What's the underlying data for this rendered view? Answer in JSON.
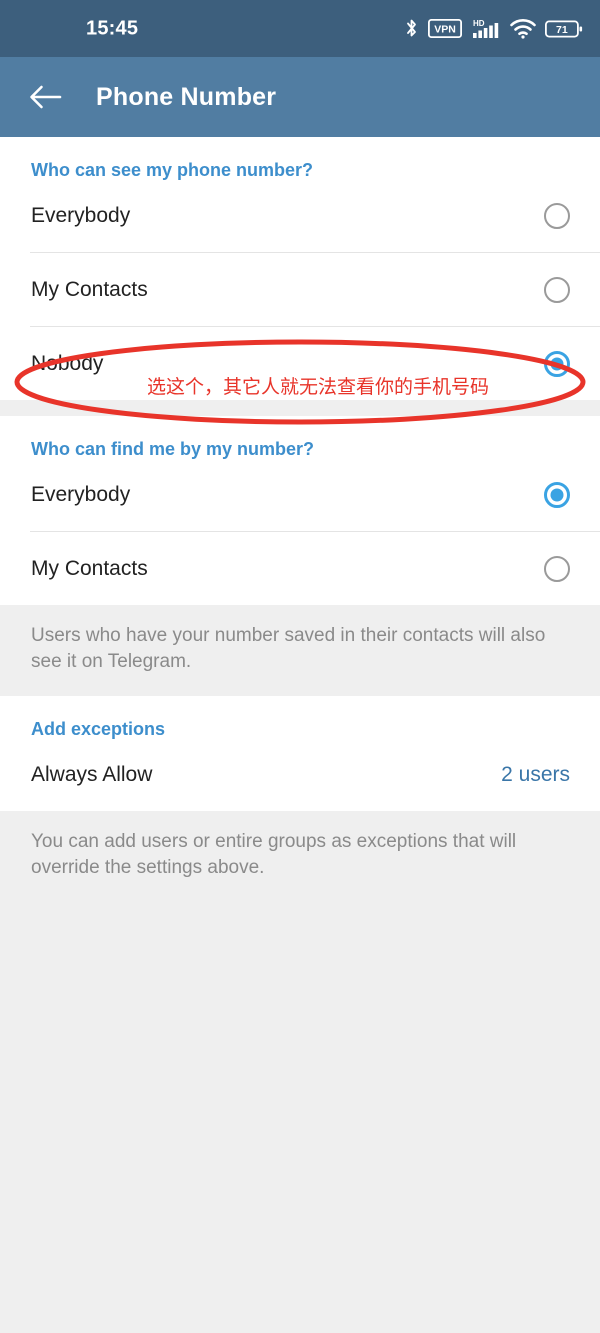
{
  "status_bar": {
    "time": "15:45",
    "battery_level": "71",
    "icons": [
      "bluetooth-icon",
      "vpn-icon",
      "hd-signal-icon",
      "wifi-icon",
      "battery-icon"
    ]
  },
  "toolbar": {
    "back_label": "back-arrow",
    "title": "Phone Number"
  },
  "sections": {
    "visibility": {
      "header": "Who can see my phone number?",
      "options": [
        {
          "label": "Everybody",
          "selected": false
        },
        {
          "label": "My Contacts",
          "selected": false
        },
        {
          "label": "Nobody",
          "selected": true
        }
      ]
    },
    "findability": {
      "header": "Who can find me by my number?",
      "options": [
        {
          "label": "Everybody",
          "selected": true
        },
        {
          "label": "My Contacts",
          "selected": false
        }
      ],
      "info": "Users who have your number saved in their contacts will also see it on Telegram."
    },
    "exceptions": {
      "header": "Add exceptions",
      "rows": [
        {
          "label": "Always Allow",
          "value": "2 users"
        }
      ],
      "info": "You can add users or entire groups as exceptions that will override the settings above."
    }
  },
  "annotation": {
    "note_text": "选这个，其它人就无法查看你的手机号码",
    "color": "#e8342a"
  },
  "colors": {
    "status_bar_bg": "#3d5f7d",
    "toolbar_bg": "#517da2",
    "accent_blue": "#3d8ecc",
    "radio_selected": "#3aa3e3",
    "value_blue": "#3a76a8",
    "page_bg": "#efefef",
    "card_bg": "#ffffff"
  }
}
